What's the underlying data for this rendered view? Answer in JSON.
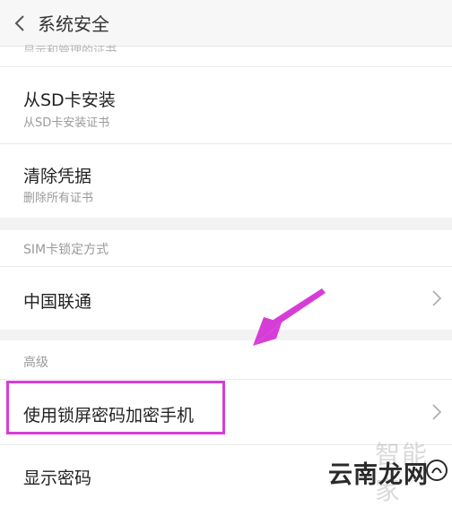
{
  "header": {
    "title": "系统安全"
  },
  "clipped_item_text": "显示和管理的证书",
  "items": [
    {
      "title": "从SD卡安装",
      "subtitle": "从SD卡安装证书"
    },
    {
      "title": "清除凭据",
      "subtitle": "删除所有证书"
    }
  ],
  "sim_section": {
    "header": "SIM卡锁定方式",
    "item": "中国联通"
  },
  "advanced_section": {
    "header": "高级",
    "items": [
      {
        "title": "使用锁屏密码加密手机"
      },
      {
        "title": "显示密码"
      }
    ]
  },
  "colors": {
    "highlight": "#d63dd8",
    "arrow": "#d63dd8"
  },
  "watermark": {
    "text": "云南龙网",
    "faint_text": "智能家"
  }
}
